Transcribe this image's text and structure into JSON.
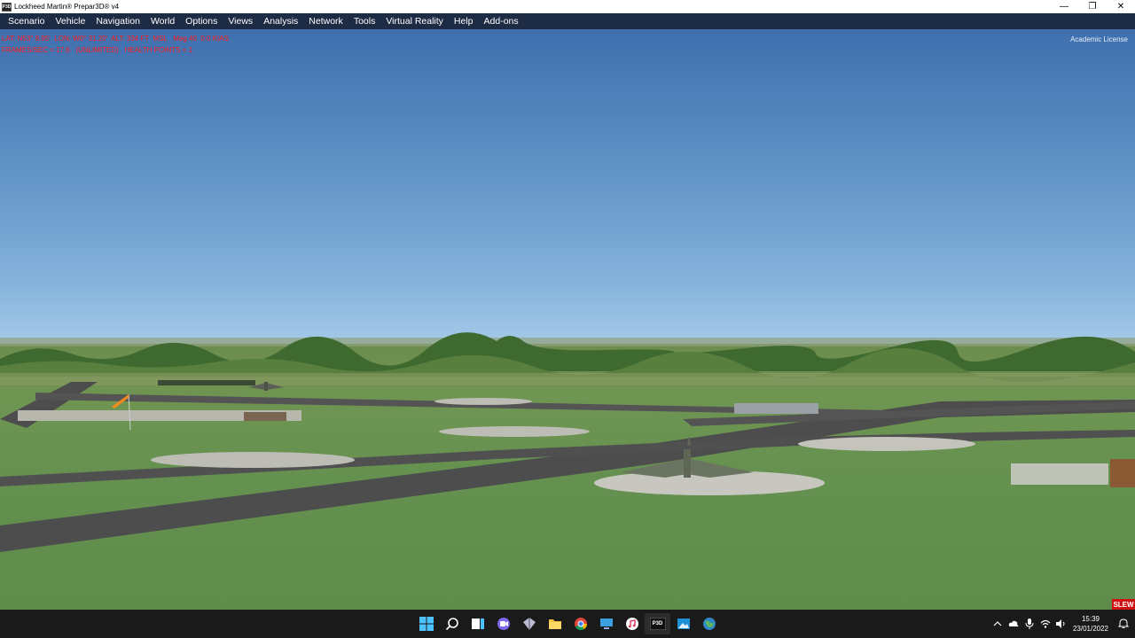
{
  "window": {
    "title": "Lockheed Martin® Prepar3D® v4",
    "icon_text": "P3D",
    "controls": {
      "minimize": "—",
      "restore": "❐",
      "close": "✕"
    }
  },
  "menu": [
    {
      "label": "Scenario"
    },
    {
      "label": "Vehicle"
    },
    {
      "label": "Navigation"
    },
    {
      "label": "World"
    },
    {
      "label": "Options"
    },
    {
      "label": "Views"
    },
    {
      "label": "Analysis"
    },
    {
      "label": "Network"
    },
    {
      "label": "Tools"
    },
    {
      "label": "Virtual Reality"
    },
    {
      "label": "Help"
    },
    {
      "label": "Add-ons"
    }
  ],
  "hud": {
    "line1": "LAT: N53° 8.95'  LON: W0° 31.20'  ALT: 334 FT  MSL   Mag 40  0.0 KIAS",
    "line2": "FRAMES/SEC = 17.6   (UNLIMITED)   HEALTH POINTS = 1",
    "license": "Academic License",
    "slew": "SLEW",
    "hud_color": "#ff1a1a"
  },
  "taskbar": {
    "icons": [
      {
        "name": "start-icon"
      },
      {
        "name": "search-icon"
      },
      {
        "name": "task-view-icon"
      },
      {
        "name": "chat-icon"
      },
      {
        "name": "pen-icon"
      },
      {
        "name": "file-explorer-icon"
      },
      {
        "name": "chrome-icon"
      },
      {
        "name": "remote-desktop-icon"
      },
      {
        "name": "music-icon"
      },
      {
        "name": "prepar3d-icon",
        "label": "P3D"
      },
      {
        "name": "photos-icon"
      },
      {
        "name": "globe-icon"
      }
    ],
    "clock_time": "15:39",
    "clock_date": "23/01/2022"
  }
}
